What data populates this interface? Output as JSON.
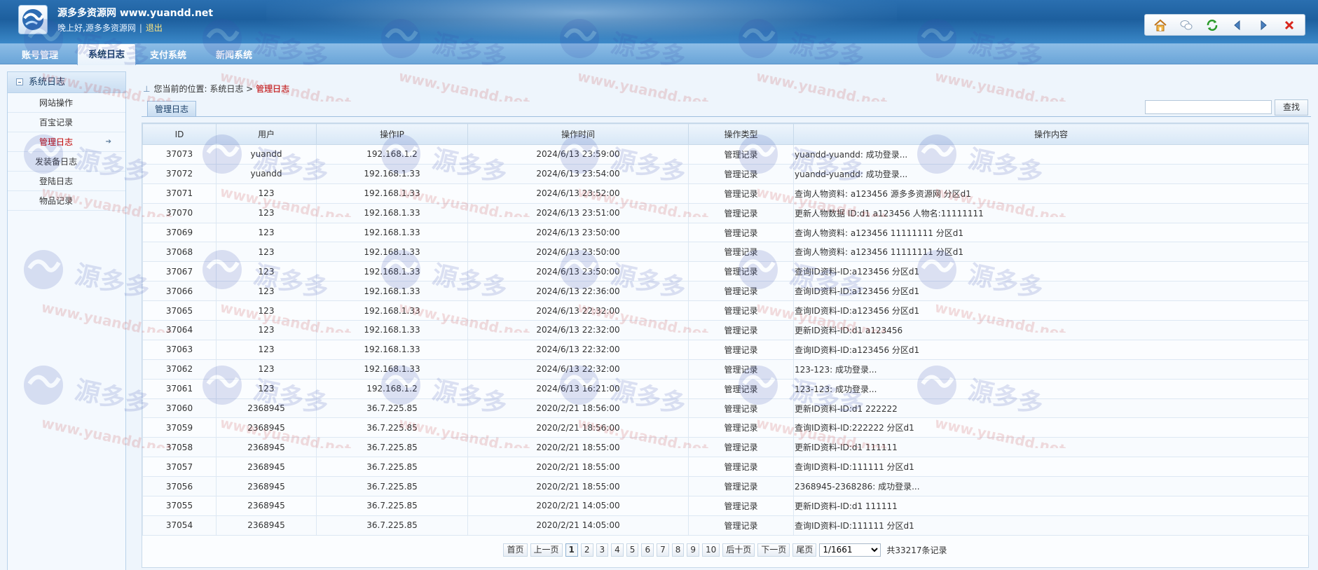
{
  "header": {
    "site_title": "源多多资源网 www.yuandd.net",
    "greeting": "晚上好,源多多资源网",
    "separator": "|",
    "logout": "退出",
    "toolbar": [
      "home-icon",
      "chat-icon",
      "refresh-icon",
      "back-icon",
      "forward-icon",
      "close-icon"
    ]
  },
  "nav": {
    "tabs": [
      {
        "label": "账号管理",
        "active": false
      },
      {
        "label": "系统日志",
        "active": true
      },
      {
        "label": "支付系统",
        "active": false
      },
      {
        "label": "新闻系统",
        "active": false
      }
    ]
  },
  "sidebar": {
    "title": "系统日志",
    "items": [
      {
        "label": "网站操作",
        "active": false
      },
      {
        "label": "百宝记录",
        "active": false
      },
      {
        "label": "管理日志",
        "active": true
      },
      {
        "label": "发装备日志",
        "active": false
      },
      {
        "label": "登陆日志",
        "active": false
      },
      {
        "label": "物品记录",
        "active": false
      }
    ]
  },
  "breadcrumb": {
    "prefix": "您当前的位置:",
    "parent": "系统日志",
    "arrow": ">",
    "current": "管理日志"
  },
  "subtab": "管理日志",
  "search": {
    "button": "查找",
    "placeholder": ""
  },
  "table": {
    "headers": [
      "ID",
      "用户",
      "操作IP",
      "操作时间",
      "操作类型",
      "操作内容"
    ],
    "rows": [
      [
        "37073",
        "yuandd",
        "192.168.1.2",
        "2024/6/13 23:59:00",
        "管理记录",
        "yuandd-yuandd: 成功登录..."
      ],
      [
        "37072",
        "yuandd",
        "192.168.1.33",
        "2024/6/13 23:54:00",
        "管理记录",
        "yuandd-yuandd: 成功登录..."
      ],
      [
        "37071",
        "123",
        "192.168.1.33",
        "2024/6/13 23:52:00",
        "管理记录",
        "查询人物资料: a123456 源多多资源网 分区d1"
      ],
      [
        "37070",
        "123",
        "192.168.1.33",
        "2024/6/13 23:51:00",
        "管理记录",
        "更新人物数据 ID:d1 a123456 人物名:11111111"
      ],
      [
        "37069",
        "123",
        "192.168.1.33",
        "2024/6/13 23:50:00",
        "管理记录",
        "查询人物资料: a123456 11111111 分区d1"
      ],
      [
        "37068",
        "123",
        "192.168.1.33",
        "2024/6/13 23:50:00",
        "管理记录",
        "查询人物资料: a123456 11111111 分区d1"
      ],
      [
        "37067",
        "123",
        "192.168.1.33",
        "2024/6/13 23:50:00",
        "管理记录",
        "查询ID资料-ID:a123456 分区d1"
      ],
      [
        "37066",
        "123",
        "192.168.1.33",
        "2024/6/13 22:36:00",
        "管理记录",
        "查询ID资料-ID:a123456 分区d1"
      ],
      [
        "37065",
        "123",
        "192.168.1.33",
        "2024/6/13 22:32:00",
        "管理记录",
        "查询ID资料-ID:a123456 分区d1"
      ],
      [
        "37064",
        "123",
        "192.168.1.33",
        "2024/6/13 22:32:00",
        "管理记录",
        "更新ID资料-ID:d1 a123456"
      ],
      [
        "37063",
        "123",
        "192.168.1.33",
        "2024/6/13 22:32:00",
        "管理记录",
        "查询ID资料-ID:a123456 分区d1"
      ],
      [
        "37062",
        "123",
        "192.168.1.33",
        "2024/6/13 22:32:00",
        "管理记录",
        "123-123: 成功登录..."
      ],
      [
        "37061",
        "123",
        "192.168.1.2",
        "2024/6/13 16:21:00",
        "管理记录",
        "123-123: 成功登录..."
      ],
      [
        "37060",
        "2368945",
        "36.7.225.85",
        "2020/2/21 18:56:00",
        "管理记录",
        "更新ID资料-ID:d1 222222"
      ],
      [
        "37059",
        "2368945",
        "36.7.225.85",
        "2020/2/21 18:56:00",
        "管理记录",
        "查询ID资料-ID:222222 分区d1"
      ],
      [
        "37058",
        "2368945",
        "36.7.225.85",
        "2020/2/21 18:55:00",
        "管理记录",
        "更新ID资料-ID:d1 111111"
      ],
      [
        "37057",
        "2368945",
        "36.7.225.85",
        "2020/2/21 18:55:00",
        "管理记录",
        "查询ID资料-ID:111111 分区d1"
      ],
      [
        "37056",
        "2368945",
        "36.7.225.85",
        "2020/2/21 18:55:00",
        "管理记录",
        "2368945-2368286: 成功登录..."
      ],
      [
        "37055",
        "2368945",
        "36.7.225.85",
        "2020/2/21 14:05:00",
        "管理记录",
        "更新ID资料-ID:d1 111111"
      ],
      [
        "37054",
        "2368945",
        "36.7.225.85",
        "2020/2/21 14:05:00",
        "管理记录",
        "查询ID资料-ID:111111 分区d1"
      ]
    ]
  },
  "pager": {
    "first": "首页",
    "prev": "上一页",
    "pages": [
      "1",
      "2",
      "3",
      "4",
      "5",
      "6",
      "7",
      "8",
      "9",
      "10"
    ],
    "current_page": "1",
    "next_ten": "后十页",
    "next": "下一页",
    "last": "尾页",
    "select_value": "1/1661",
    "total": "共33217条记录"
  },
  "watermark": {
    "text_cn": "源多多",
    "text_url": "www.yuandd.net"
  },
  "colors": {
    "accent": "#1d5f9e",
    "active_text": "#c00000",
    "nav": "#6aa5d8"
  }
}
